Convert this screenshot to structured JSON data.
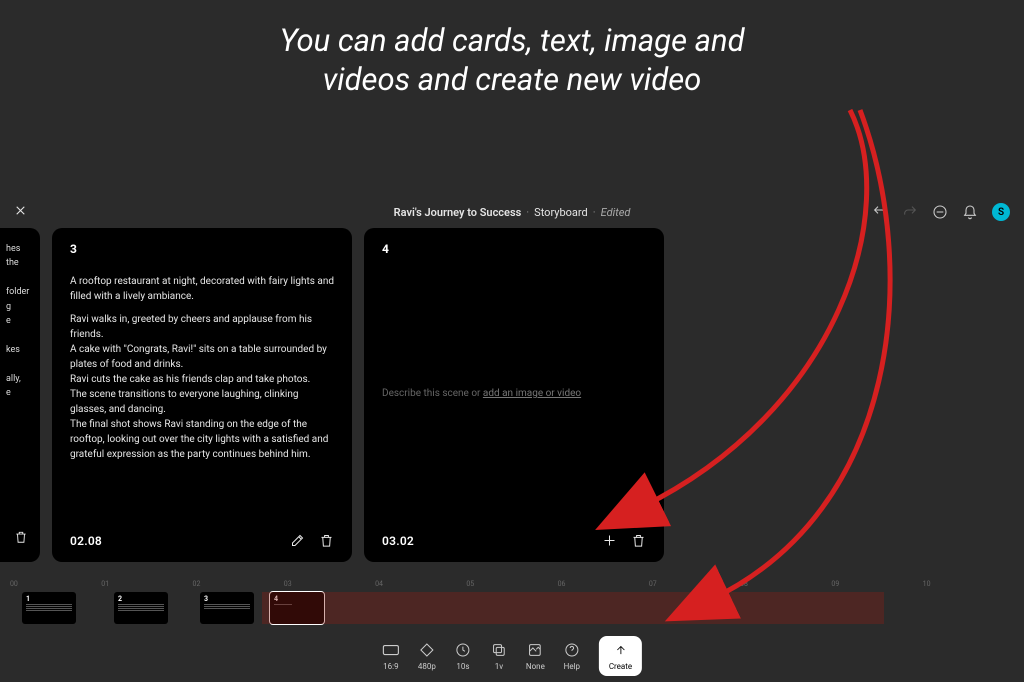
{
  "annotation": "You can add cards, text, image and videos and create new video",
  "header": {
    "project_title": "Ravi's Journey to Success",
    "section": "Storyboard",
    "status": "Edited",
    "avatar_initial": "S"
  },
  "cards": {
    "partial_left": {
      "snippets": [
        "hes the",
        "folder",
        "g",
        "e",
        "kes",
        "ally,",
        "e"
      ]
    },
    "c3": {
      "num": "3",
      "time": "02.08",
      "p1": "A rooftop restaurant at night, decorated with fairy lights and filled with a lively ambiance.",
      "p2": "Ravi walks in, greeted by cheers and applause from his friends.",
      "p3": "A cake with \"Congrats, Ravi!\" sits on a table surrounded by plates of food and drinks.",
      "p4": "Ravi cuts the cake as his friends clap and take photos.",
      "p5": "The scene transitions to everyone laughing, clinking glasses, and dancing.",
      "p6": "The final shot shows Ravi standing on the edge of the rooftop, looking out over the city lights with a satisfied and grateful expression as the party continues behind him."
    },
    "c4": {
      "num": "4",
      "time": "03.02",
      "placeholder_prefix": "Describe this scene or ",
      "placeholder_link": "add an image or video"
    }
  },
  "minimap": {
    "ticks": [
      "00",
      "01",
      "02",
      "03",
      "04",
      "05",
      "06",
      "07",
      "08",
      "09",
      "10"
    ],
    "thumbs": [
      {
        "n": "1"
      },
      {
        "n": "2"
      },
      {
        "n": "3"
      },
      {
        "n": "4",
        "selected": true
      }
    ]
  },
  "toolbar": {
    "aspect": "16:9",
    "res": "480p",
    "duration": "10s",
    "version": "1v",
    "style": "None",
    "help": "Help",
    "create": "Create"
  }
}
